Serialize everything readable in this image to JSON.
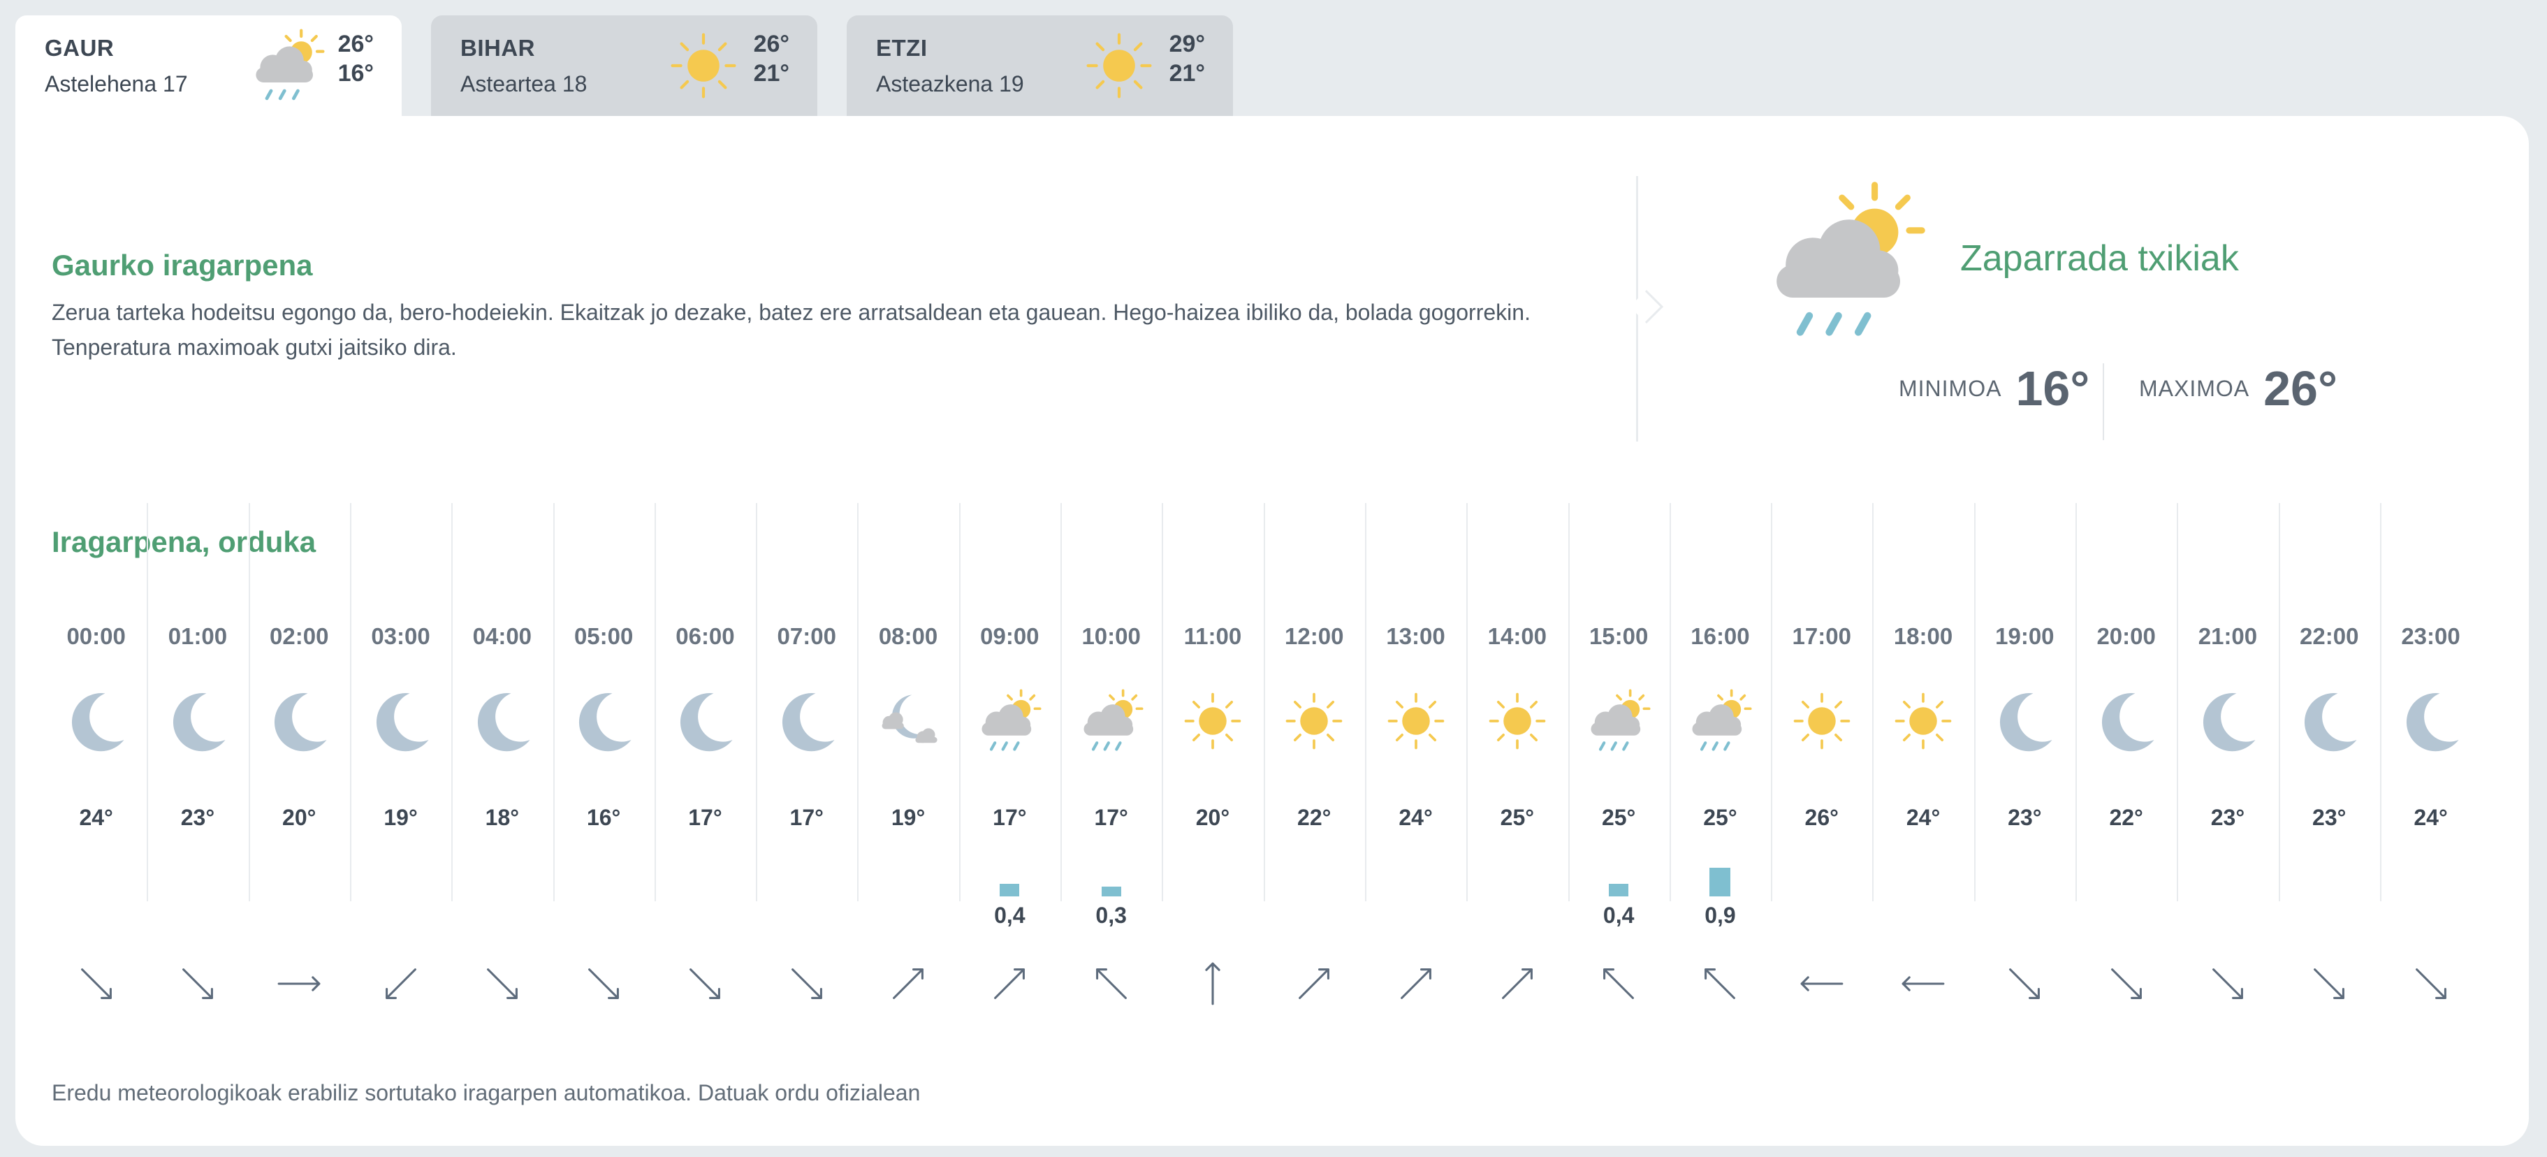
{
  "tabs": [
    {
      "day": "GAUR",
      "date": "Astelehena 17",
      "max": "26°",
      "min": "16°",
      "icon": "cloud-sun-rain-icon",
      "active": true
    },
    {
      "day": "BIHAR",
      "date": "Asteartea 18",
      "max": "26°",
      "min": "21°",
      "icon": "sun-icon",
      "active": false
    },
    {
      "day": "ETZI",
      "date": "Asteazkena 19",
      "max": "29°",
      "min": "21°",
      "icon": "sun-icon",
      "active": false
    }
  ],
  "daily": {
    "title": "Gaurko iragarpena",
    "text": "Zerua tarteka hodeitsu egongo da, bero-hodeiekin. Ekaitzak jo dezake, batez ere arratsaldean eta gauean. Hego-haizea ibiliko da, bolada gogorrekin. Tenperatura maximoak gutxi jaitsiko dira.",
    "condition": "Zaparrada txikiak",
    "icon": "cloud-sun-rain-icon",
    "min_label": "MINIMOA",
    "min_value": "16°",
    "max_label": "MAXIMOA",
    "max_value": "26°"
  },
  "hourly": {
    "title": "Iragarpena, orduka",
    "hours": [
      {
        "time": "00:00",
        "temp": "24°",
        "icon": "moon-icon",
        "rain": "",
        "rain_mm": 0,
        "wind_deg": 135
      },
      {
        "time": "01:00",
        "temp": "23°",
        "icon": "moon-icon",
        "rain": "",
        "rain_mm": 0,
        "wind_deg": 135
      },
      {
        "time": "02:00",
        "temp": "20°",
        "icon": "moon-icon",
        "rain": "",
        "rain_mm": 0,
        "wind_deg": 90
      },
      {
        "time": "03:00",
        "temp": "19°",
        "icon": "moon-icon",
        "rain": "",
        "rain_mm": 0,
        "wind_deg": 225
      },
      {
        "time": "04:00",
        "temp": "18°",
        "icon": "moon-icon",
        "rain": "",
        "rain_mm": 0,
        "wind_deg": 135
      },
      {
        "time": "05:00",
        "temp": "16°",
        "icon": "moon-icon",
        "rain": "",
        "rain_mm": 0,
        "wind_deg": 135
      },
      {
        "time": "06:00",
        "temp": "17°",
        "icon": "moon-icon",
        "rain": "",
        "rain_mm": 0,
        "wind_deg": 135
      },
      {
        "time": "07:00",
        "temp": "17°",
        "icon": "moon-icon",
        "rain": "",
        "rain_mm": 0,
        "wind_deg": 135
      },
      {
        "time": "08:00",
        "temp": "19°",
        "icon": "moon-cloud-icon",
        "rain": "",
        "rain_mm": 0,
        "wind_deg": 45
      },
      {
        "time": "09:00",
        "temp": "17°",
        "icon": "cloud-sun-rain-icon",
        "rain": "0,4",
        "rain_mm": 0.4,
        "wind_deg": 45
      },
      {
        "time": "10:00",
        "temp": "17°",
        "icon": "cloud-sun-rain-icon",
        "rain": "0,3",
        "rain_mm": 0.3,
        "wind_deg": 315
      },
      {
        "time": "11:00",
        "temp": "20°",
        "icon": "sun-icon",
        "rain": "",
        "rain_mm": 0,
        "wind_deg": 0
      },
      {
        "time": "12:00",
        "temp": "22°",
        "icon": "sun-icon",
        "rain": "",
        "rain_mm": 0,
        "wind_deg": 45
      },
      {
        "time": "13:00",
        "temp": "24°",
        "icon": "sun-icon",
        "rain": "",
        "rain_mm": 0,
        "wind_deg": 45
      },
      {
        "time": "14:00",
        "temp": "25°",
        "icon": "sun-icon",
        "rain": "",
        "rain_mm": 0,
        "wind_deg": 45
      },
      {
        "time": "15:00",
        "temp": "25°",
        "icon": "cloud-sun-rain-icon",
        "rain": "0,4",
        "rain_mm": 0.4,
        "wind_deg": 315
      },
      {
        "time": "16:00",
        "temp": "25°",
        "icon": "cloud-sun-rain-icon",
        "rain": "0,9",
        "rain_mm": 0.9,
        "wind_deg": 315
      },
      {
        "time": "17:00",
        "temp": "26°",
        "icon": "sun-icon",
        "rain": "",
        "rain_mm": 0,
        "wind_deg": 270
      },
      {
        "time": "18:00",
        "temp": "24°",
        "icon": "sun-icon",
        "rain": "",
        "rain_mm": 0,
        "wind_deg": 270
      },
      {
        "time": "19:00",
        "temp": "23°",
        "icon": "moon-icon",
        "rain": "",
        "rain_mm": 0,
        "wind_deg": 135
      },
      {
        "time": "20:00",
        "temp": "22°",
        "icon": "moon-icon",
        "rain": "",
        "rain_mm": 0,
        "wind_deg": 135
      },
      {
        "time": "21:00",
        "temp": "23°",
        "icon": "moon-icon",
        "rain": "",
        "rain_mm": 0,
        "wind_deg": 135
      },
      {
        "time": "22:00",
        "temp": "23°",
        "icon": "moon-icon",
        "rain": "",
        "rain_mm": 0,
        "wind_deg": 135
      },
      {
        "time": "23:00",
        "temp": "24°",
        "icon": "moon-icon",
        "rain": "",
        "rain_mm": 0,
        "wind_deg": 135
      }
    ]
  },
  "footer": "Eredu meteorologikoak erabiliz sortutako iragarpen automatikoa. Datuak ordu ofizialean",
  "colors": {
    "accent_green": "#4f9e73",
    "sun": "#f5c94f",
    "cloud": "#c5c6c8",
    "moon": "#b4c5d3",
    "rain": "#7fbfd0",
    "wind": "#5d6b7c"
  }
}
